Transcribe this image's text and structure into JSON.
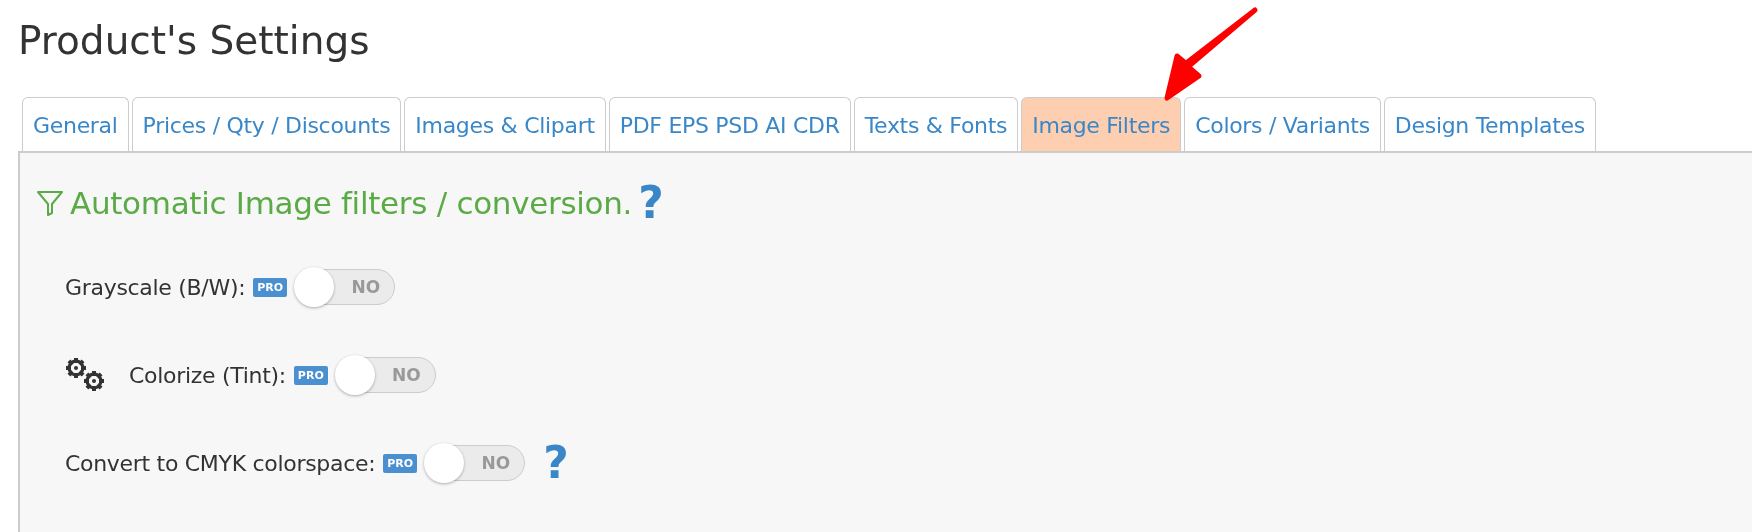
{
  "page_title": "Product's Settings",
  "tabs": [
    {
      "label": "General",
      "selected": false
    },
    {
      "label": "Prices / Qty / Discounts",
      "selected": false
    },
    {
      "label": "Images & Clipart",
      "selected": false
    },
    {
      "label": "PDF EPS PSD AI CDR",
      "selected": false
    },
    {
      "label": "Texts & Fonts",
      "selected": false
    },
    {
      "label": "Image Filters",
      "selected": true
    },
    {
      "label": "Colors / Variants",
      "selected": false
    },
    {
      "label": "Design Templates",
      "selected": false
    }
  ],
  "section": {
    "heading": "Automatic Image filters / conversion.",
    "help": "?"
  },
  "settings": [
    {
      "kind": "plain",
      "label": "Grayscale (B/W):",
      "badge": "PRO",
      "on": false,
      "toggle_text": "NO"
    },
    {
      "kind": "gears",
      "label": "Colorize (Tint):",
      "badge": "PRO",
      "on": false,
      "toggle_text": "NO"
    },
    {
      "kind": "plain",
      "label": "Convert to CMYK colorspace:",
      "badge": "PRO",
      "on": false,
      "toggle_text": "NO",
      "help": "?"
    }
  ]
}
